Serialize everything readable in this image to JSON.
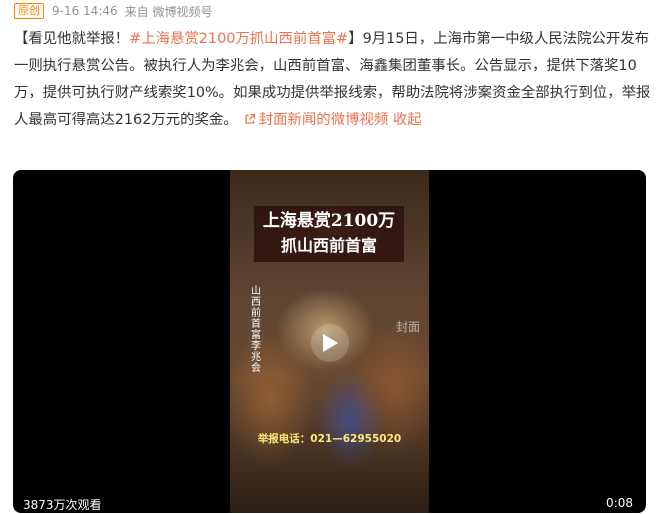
{
  "meta": {
    "badge": "原创",
    "timestamp": "9-16 14:46",
    "source": "来自 微博视频号"
  },
  "post": {
    "intro": "【看见他就举报！",
    "topic": "#上海悬赏2100万抓山西前首富#",
    "body": "】9月15日，上海市第一中级人民法院公开发布一则执行悬赏公告。被执行人为李兆会，山西前首富、海鑫集团董事长。公告显示，提供下落奖10万，提供可执行财产线索奖10%。如果成功提供举报线索，帮助法院将涉案资金全部执行到位，举报人最高可得高达2162万元的奖金。",
    "link_label": "封面新闻的微博视频",
    "link_icon": "link-icon",
    "collapse_label": "收起"
  },
  "video": {
    "headline_line1": "上海悬赏2100万",
    "headline_line2": "抓山西前首富",
    "vertical_caption": "山西前首富李兆会",
    "watermark": "封面",
    "report_line": "举报电话：021—62955020",
    "view_count": "3873万次观看",
    "duration": "0:08",
    "play_icon": "play-icon"
  },
  "colors": {
    "accent": "#eb7350",
    "badge": "#ff8200",
    "meta": "#939393",
    "report_text": "#ffe97a"
  }
}
